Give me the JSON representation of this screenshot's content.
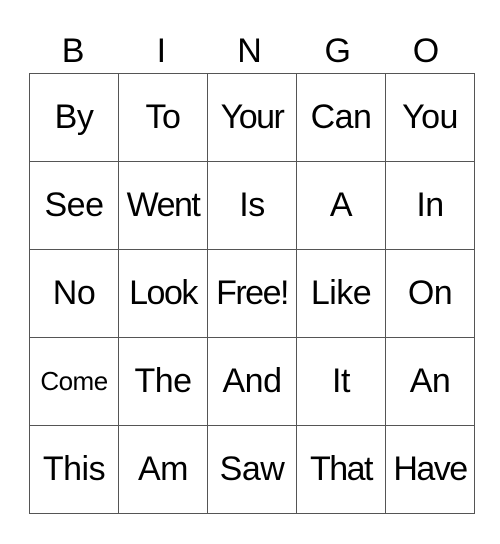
{
  "header": [
    "B",
    "I",
    "N",
    "G",
    "O"
  ],
  "rows": [
    [
      "By",
      "To",
      "Your",
      "Can",
      "You"
    ],
    [
      "See",
      "Went",
      "Is",
      "A",
      "In"
    ],
    [
      "No",
      "Look",
      "Free!",
      "Like",
      "On"
    ],
    [
      "Come",
      "The",
      "And",
      "It",
      "An"
    ],
    [
      "This",
      "Am",
      "Saw",
      "That",
      "Have"
    ]
  ]
}
